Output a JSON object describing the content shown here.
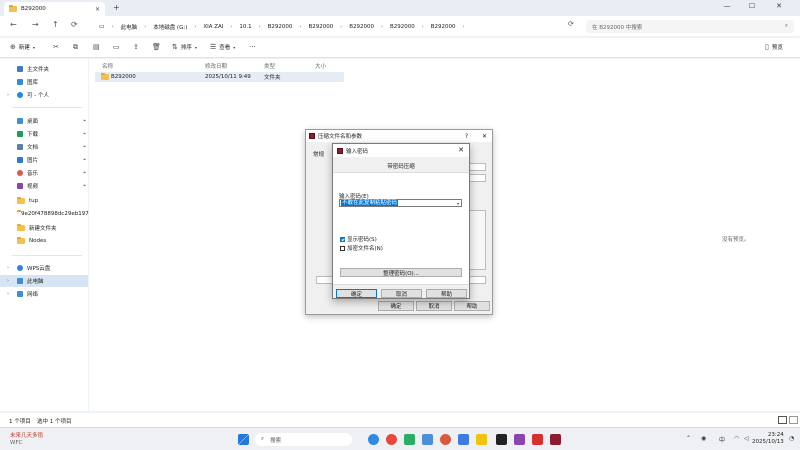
{
  "window": {
    "tab_title": "B292000",
    "new_tab": "+",
    "controls": {
      "minimize": "—",
      "maximize": "☐",
      "close": "✕"
    }
  },
  "address": {
    "crumbs": [
      "此电脑",
      "本地磁盘 (G:)",
      "XIA ZAI",
      "10.1",
      "B292000",
      "B292000",
      "B292000",
      "B292000",
      "B292000"
    ],
    "search_placeholder": "在 B292000 中搜索"
  },
  "toolbar": {
    "new_label": "新建",
    "sort_label": "排序",
    "view_label": "查看",
    "more_label": "···",
    "details_label": "预览"
  },
  "sidebar": {
    "items": [
      {
        "label": "主文件夹",
        "icon": "home-icon",
        "color": "#3d7cc9"
      },
      {
        "label": "图库",
        "icon": "gallery-icon",
        "color": "#2e8bd6"
      },
      {
        "label": "可 - 个人",
        "icon": "cloud-icon",
        "color": "#1e88e5"
      },
      {
        "label": "桌面",
        "icon": "desktop-icon",
        "color": "#3f8fd8"
      },
      {
        "label": "下载",
        "icon": "download-icon",
        "color": "#1f9d55"
      },
      {
        "label": "文档",
        "icon": "document-icon",
        "color": "#5b7fa8"
      },
      {
        "label": "图片",
        "icon": "picture-icon",
        "color": "#2c7bd1"
      },
      {
        "label": "音乐",
        "icon": "music-icon",
        "color": "#e0574f"
      },
      {
        "label": "视频",
        "icon": "video-icon",
        "color": "#8e44ad"
      },
      {
        "label": "tup",
        "icon": "folder-icon",
        "color": "#f2c14e"
      },
      {
        "label": "9e20f478898dc29eb1974",
        "icon": "folder-icon",
        "color": "#f2c14e"
      },
      {
        "label": "新建文件夹",
        "icon": "folder-icon",
        "color": "#f2c14e"
      },
      {
        "label": "Nodes",
        "icon": "folder-icon",
        "color": "#f2c14e"
      },
      {
        "label": "WPS云盘",
        "icon": "wps-cloud-icon",
        "color": "#2f80ed"
      },
      {
        "label": "此电脑",
        "icon": "computer-icon",
        "color": "#3f8fd8"
      },
      {
        "label": "网络",
        "icon": "network-icon",
        "color": "#3f8fd8"
      }
    ]
  },
  "files": {
    "columns": [
      "名称",
      "修改日期",
      "类型",
      "大小"
    ],
    "rows": [
      {
        "name": "B292000",
        "modified": "2025/10/11 9:49",
        "type": "文件夹",
        "size": ""
      }
    ],
    "preview_note": "没有预览。"
  },
  "status": {
    "count": "1 个项目",
    "selected": "选中 1 个项目"
  },
  "compress_dialog": {
    "title": "压缩文件名和参数",
    "tab_general": "常规",
    "ok": "确定",
    "cancel": "取消",
    "help": "帮助"
  },
  "password_dialog": {
    "title": "输入密码",
    "heading": "带密码压缩",
    "input_label": "输入密码(E)",
    "password_value": "不敢在此复制粘贴密码",
    "show_password": "显示密码(S)",
    "show_password_checked": true,
    "encrypt_names": "加密文件名(N)",
    "encrypt_names_checked": false,
    "organize": "整理密码(O)...",
    "ok": "确定",
    "cancel": "取消",
    "help": "帮助"
  },
  "taskbar": {
    "weather_temp": "未来几天多雨",
    "weather_sub": "WFC",
    "search_label": "搜索",
    "ime": "中",
    "time": "23:24",
    "date": "2025/10/13"
  }
}
